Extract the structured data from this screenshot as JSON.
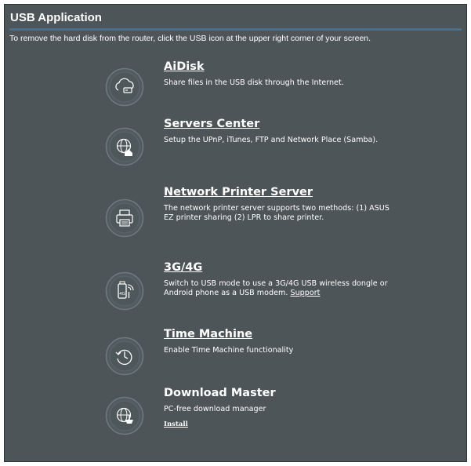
{
  "header": {
    "title": "USB Application",
    "hint": "To remove the hard disk from the router, click the USB icon at the upper right corner of your screen."
  },
  "apps": [
    {
      "title": "AiDisk",
      "desc": "Share files in the USB disk through the Internet.",
      "icon": "cloud-disk-icon"
    },
    {
      "title": "Servers Center",
      "desc": "Setup the UPnP, iTunes, FTP and Network Place (Samba).",
      "icon": "globe-server-icon"
    },
    {
      "title": "Network Printer Server",
      "desc": "The network printer server supports two methods: (1) ASUS EZ printer sharing (2) LPR to share printer.",
      "icon": "printer-icon"
    },
    {
      "title": "3G/4G",
      "desc": "Switch to USB mode to use a 3G/4G USB wireless dongle or Android phone as a USB modem.",
      "link": "Support",
      "icon": "usb-modem-icon"
    },
    {
      "title": "Time Machine",
      "desc": "Enable Time Machine functionality",
      "icon": "time-machine-icon"
    },
    {
      "title": "Download Master",
      "desc": "PC-free download manager",
      "link": "Install",
      "icon": "download-globe-icon"
    }
  ],
  "colors": {
    "panel": "#4d5558",
    "divider": "#4a6f86",
    "icon_ring": "#6f7a7f",
    "text": "#ffffff"
  }
}
